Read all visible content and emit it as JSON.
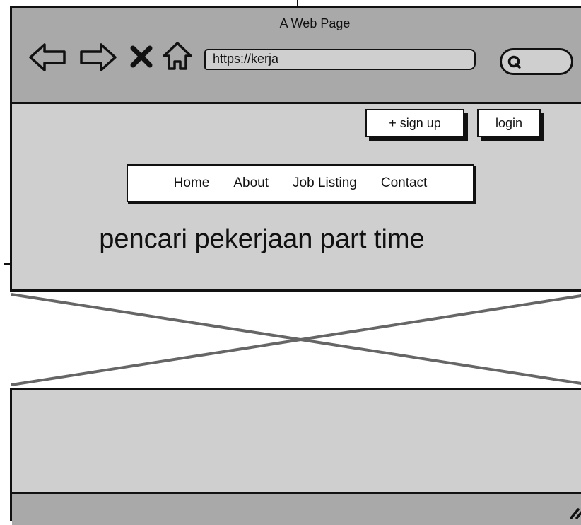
{
  "window": {
    "title": "A Web Page"
  },
  "browser": {
    "address_value": "https://kerja",
    "icons": [
      "back-arrow-icon",
      "forward-arrow-icon",
      "close-x-icon",
      "home-icon",
      "search-icon",
      "resize-handle-icon"
    ]
  },
  "auth": {
    "signup_label": "+ sign up",
    "login_label": "login"
  },
  "menu": {
    "items": [
      {
        "label": "Home"
      },
      {
        "label": "About"
      },
      {
        "label": "Job Listing"
      },
      {
        "label": "Contact"
      }
    ]
  },
  "hero": {
    "headline": "pencari pekerjaan part time"
  },
  "colors": {
    "chrome": "#a9a9a9",
    "page": "#cfcfcf",
    "white": "#ffffff",
    "ink": "#111111"
  }
}
